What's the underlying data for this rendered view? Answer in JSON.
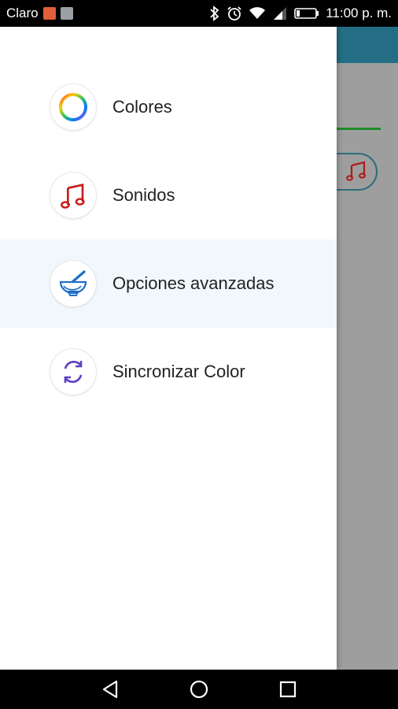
{
  "status_bar": {
    "carrier": "Claro",
    "time": "11:00 p. m.",
    "icons": [
      "notification-app-icon",
      "image-notification-icon",
      "bluetooth-icon",
      "alarm-icon",
      "wifi-icon",
      "signal-icon",
      "battery-icon"
    ]
  },
  "drawer": {
    "items": [
      {
        "label": "Colores",
        "icon": "color-ring-icon",
        "active": false
      },
      {
        "label": "Sonidos",
        "icon": "music-note-icon",
        "active": false
      },
      {
        "label": "Opciones avanzadas",
        "icon": "mortar-pestle-icon",
        "active": true
      },
      {
        "label": "Sincronizar Color",
        "icon": "sync-icon",
        "active": false
      }
    ]
  },
  "colors": {
    "toolbar": "#236e84",
    "active_item_bg": "#f1f8fb",
    "accent_green": "#1f8a2a",
    "music_red": "#c81e1e"
  },
  "nav_bar": {
    "icons": [
      "back-icon",
      "home-icon",
      "recents-icon"
    ]
  }
}
